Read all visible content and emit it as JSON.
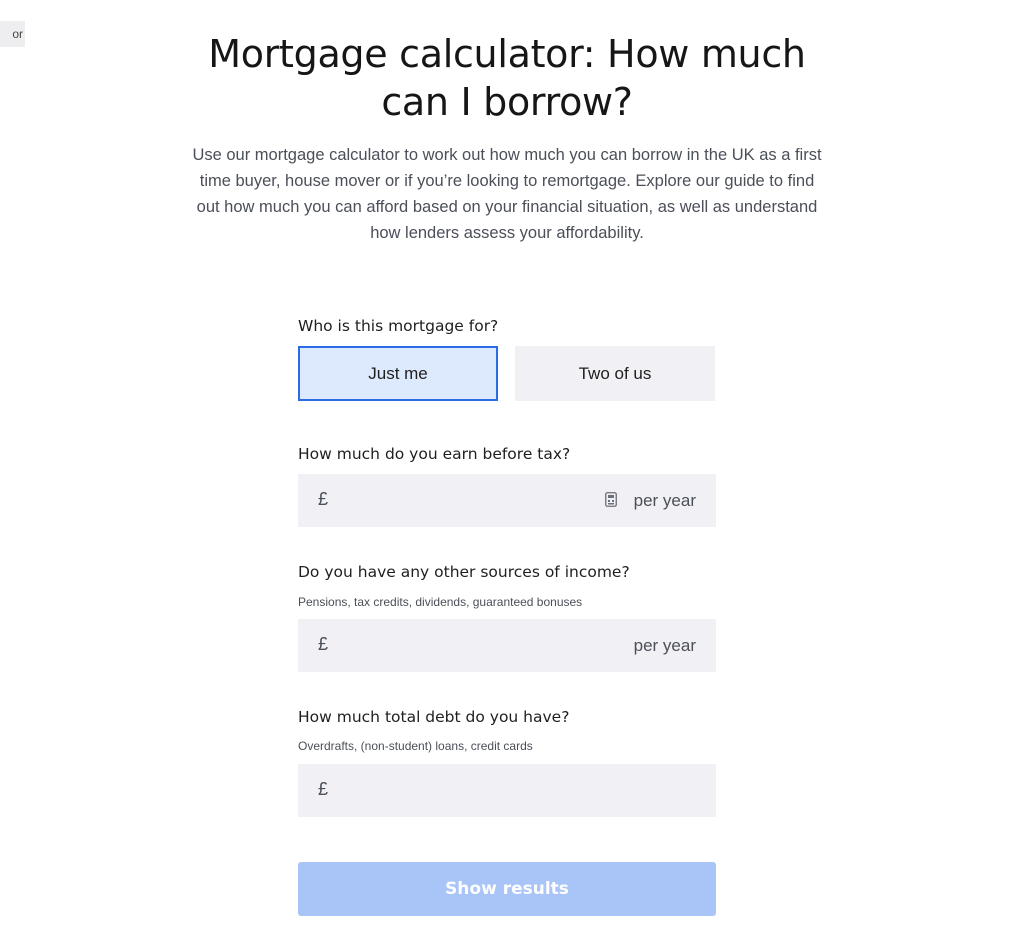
{
  "corner_tag": "or",
  "header": {
    "title": "Mortgage calculator: How much can I borrow?",
    "intro": "Use our mortgage calculator to work out how much you can borrow in the UK as a first time buyer, house mover or if you’re looking to remortgage. Explore our guide to find out how much you can afford based on your financial situation, as well as understand how lenders assess your affordability."
  },
  "form": {
    "who_for": {
      "label": "Who is this mortgage for?",
      "options": [
        "Just me",
        "Two of us"
      ],
      "selected": "Just me"
    },
    "income": {
      "label": "How much do you earn before tax?",
      "currency": "£",
      "value": "",
      "suffix": "per year",
      "icon": "calculator-icon"
    },
    "other_income": {
      "label": "Do you have any other sources of income?",
      "hint": "Pensions, tax credits, dividends, guaranteed bonuses",
      "currency": "£",
      "value": "",
      "suffix": "per year"
    },
    "debt": {
      "label": "How much total debt do you have?",
      "hint": "Overdrafts, (non-student) loans, credit cards",
      "currency": "£",
      "value": ""
    },
    "submit_label": "Show results"
  },
  "colors": {
    "accent": "#2b6be4",
    "selected_bg": "#dde9fd",
    "field_bg": "#f1f1f5",
    "button_disabled": "#a9c4f6"
  }
}
